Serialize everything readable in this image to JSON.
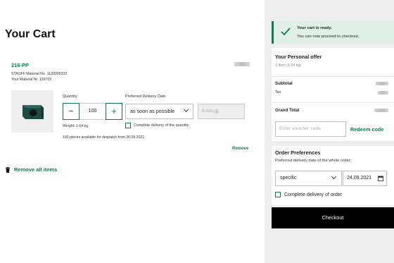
{
  "cart": {
    "title": "Your Cart",
    "remove_all_label": "Remove all items"
  },
  "item": {
    "code": "216-PP",
    "material_no": "STAUFF Material No. 1130005333",
    "your_material": "Your Material Nr. 139703",
    "quantity_label": "Quantity:",
    "quantity_value": "100",
    "delivery_date_label": "Preferred Delivery Date",
    "delivery_option": "as soon as possible",
    "date_placeholder": "tt.mm.jjjj",
    "weight": "Weight: 1.64 kg",
    "complete_delivery_label": "Complete delivery of the quantity",
    "complete_delivery_checked": false,
    "availability": "100 pieces available for despatch from 20.09.2021",
    "remove_label": "Remove"
  },
  "notice": {
    "title": "Your cart is ready.",
    "text": "You can now proceed to checkout."
  },
  "offer": {
    "title": "Your Personal offer",
    "item_count": "1 Item (1.64 kg)",
    "subtotal_label": "Subtotal",
    "tax_label": "Tax",
    "grand_total_label": "Grand Total",
    "voucher_placeholder": "Enter voucher code",
    "redeem_label": "Redeem code"
  },
  "preferences": {
    "title": "Order Preferences",
    "subtitle": "Preferred delivery date of the whole order:",
    "mode_value": "specific",
    "date_value": "24.09.2021",
    "complete_label": "Complete delivery of order",
    "complete_checked": false
  },
  "checkout": {
    "label": "Checkout"
  },
  "colors": {
    "accent": "#0d7a4f",
    "sidebar_bg": "#eeeeee",
    "notice_bg": "#e0f0e6",
    "checkout_bg": "#000000"
  }
}
